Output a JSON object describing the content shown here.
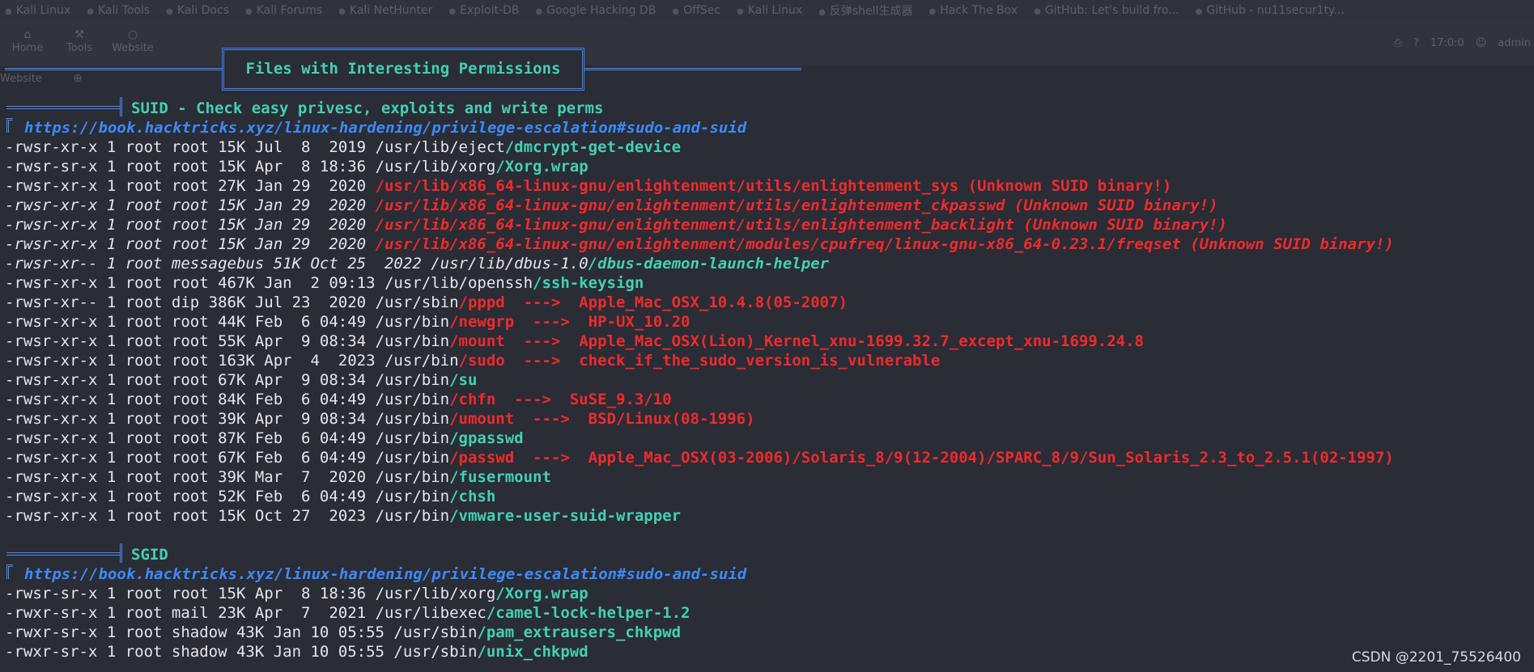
{
  "browser": {
    "bookmarks": [
      "Kali Linux",
      "Kali Tools",
      "Kali Docs",
      "Kali Forums",
      "Kali NetHunter",
      "Exploit-DB",
      "Google Hacking DB",
      "OffSec",
      "Kali Linux",
      "反弹shell生成器",
      "Hack The Box",
      "GitHub: Let's build fro...",
      "GitHub - nu11secur1ty..."
    ],
    "nav_items": [
      {
        "label": "Home",
        "icon": "home-icon"
      },
      {
        "label": "Tools",
        "icon": "wrench-icon"
      },
      {
        "label": "Website",
        "icon": "globe-icon"
      }
    ],
    "progress_text": "17:0:0",
    "user": "admin",
    "website_tab": "Website"
  },
  "header": {
    "title": "Files with Interesting Permissions"
  },
  "suid": {
    "title": "SUID - Check easy privesc, exploits and write perms",
    "url": "https://book.hacktricks.xyz/linux-hardening/privilege-escalation#sudo-and-suid",
    "lines": [
      {
        "italic": false,
        "prefix": "-rwsr-xr-x 1 root root 15K Jul  8  2019 /usr/lib/eject",
        "hl": "/dmcrypt-get-device",
        "hl_style": "teal",
        "suffix": ""
      },
      {
        "italic": false,
        "prefix": "-rwsr-sr-x 1 root root 15K Apr  8 18:36 /usr/lib/xorg",
        "hl": "/Xorg.wrap",
        "hl_style": "teal",
        "suffix": ""
      },
      {
        "italic": false,
        "prefix": "-rwsr-xr-x 1 root root 27K Jan 29  2020 ",
        "hl": "/usr/lib/x86_64-linux-gnu/enlightenment/utils/enlightenment_sys (Unknown SUID binary!)",
        "hl_style": "red",
        "suffix": ""
      },
      {
        "italic": true,
        "prefix": "-rwsr-xr-x 1 root root 15K Jan 29  2020 ",
        "hl": "/usr/lib/x86_64-linux-gnu/enlightenment/utils/enlightenment_ckpasswd (Unknown SUID binary!)",
        "hl_style": "redi",
        "suffix": ""
      },
      {
        "italic": true,
        "prefix": "-rwsr-xr-x 1 root root 15K Jan 29  2020 ",
        "hl": "/usr/lib/x86_64-linux-gnu/enlightenment/utils/enlightenment_backlight (Unknown SUID binary!)",
        "hl_style": "redi",
        "suffix": ""
      },
      {
        "italic": true,
        "prefix": "-rwsr-xr-x 1 root root 15K Jan 29  2020 ",
        "hl": "/usr/lib/x86_64-linux-gnu/enlightenment/modules/cpufreq/linux-gnu-x86_64-0.23.1/freqset (Unknown SUID binary!)",
        "hl_style": "redi",
        "suffix": ""
      },
      {
        "italic": true,
        "prefix": "-rwsr-xr-- 1 root messagebus 51K Oct 25  2022 /usr/lib/dbus-1.0",
        "hl": "/dbus-daemon-launch-helper",
        "hl_style": "teal",
        "suffix": ""
      },
      {
        "italic": false,
        "prefix": "-rwsr-xr-x 1 root root 467K Jan  2 09:13 /usr/lib/openssh",
        "hl": "/ssh-keysign",
        "hl_style": "teal",
        "suffix": ""
      },
      {
        "italic": false,
        "prefix": "-rwsr-xr-- 1 root dip 386K Jul 23  2020 /usr/sbin",
        "hl": "/pppd  --->  Apple_Mac_OSX_10.4.8(05-2007)",
        "hl_style": "red",
        "suffix": ""
      },
      {
        "italic": false,
        "prefix": "-rwsr-xr-x 1 root root 44K Feb  6 04:49 /usr/bin",
        "hl": "/newgrp  --->  HP-UX_10.20",
        "hl_style": "red",
        "suffix": ""
      },
      {
        "italic": false,
        "prefix": "-rwsr-xr-x 1 root root 55K Apr  9 08:34 /usr/bin",
        "hl": "/mount  --->  Apple_Mac_OSX(Lion)_Kernel_xnu-1699.32.7_except_xnu-1699.24.8",
        "hl_style": "red",
        "suffix": ""
      },
      {
        "italic": false,
        "prefix": "-rwsr-xr-x 1 root root 163K Apr  4  2023 /usr/bin",
        "hl": "/sudo  --->  check_if_the_sudo_version_is_vulnerable",
        "hl_style": "red",
        "suffix": ""
      },
      {
        "italic": false,
        "prefix": "-rwsr-xr-x 1 root root 67K Apr  9 08:34 /usr/bin",
        "hl": "/su",
        "hl_style": "teal",
        "suffix": ""
      },
      {
        "italic": false,
        "prefix": "-rwsr-xr-x 1 root root 84K Feb  6 04:49 /usr/bin",
        "hl": "/chfn  --->  SuSE_9.3/10",
        "hl_style": "red",
        "suffix": ""
      },
      {
        "italic": false,
        "prefix": "-rwsr-xr-x 1 root root 39K Apr  9 08:34 /usr/bin",
        "hl": "/umount  --->  BSD/Linux(08-1996)",
        "hl_style": "red",
        "suffix": ""
      },
      {
        "italic": false,
        "prefix": "-rwsr-xr-x 1 root root 87K Feb  6 04:49 /usr/bin",
        "hl": "/gpasswd",
        "hl_style": "teal",
        "suffix": ""
      },
      {
        "italic": false,
        "prefix": "-rwsr-xr-x 1 root root 67K Feb  6 04:49 /usr/bin",
        "hl": "/passwd  --->  Apple_Mac_OSX(03-2006)/Solaris_8/9(12-2004)/SPARC_8/9/Sun_Solaris_2.3_to_2.5.1(02-1997)",
        "hl_style": "red",
        "suffix": ""
      },
      {
        "italic": false,
        "prefix": "-rwsr-xr-x 1 root root 39K Mar  7  2020 /usr/bin",
        "hl": "/fusermount",
        "hl_style": "teal",
        "suffix": ""
      },
      {
        "italic": false,
        "prefix": "-rwsr-xr-x 1 root root 52K Feb  6 04:49 /usr/bin",
        "hl": "/chsh",
        "hl_style": "teal",
        "suffix": ""
      },
      {
        "italic": false,
        "prefix": "-rwsr-xr-x 1 root root 15K Oct 27  2023 /usr/bin",
        "hl": "/vmware-user-suid-wrapper",
        "hl_style": "teal",
        "suffix": ""
      }
    ]
  },
  "sgid": {
    "title": "SGID",
    "url": "https://book.hacktricks.xyz/linux-hardening/privilege-escalation#sudo-and-suid",
    "lines": [
      {
        "italic": false,
        "prefix": "-rwsr-sr-x 1 root root 15K Apr  8 18:36 /usr/lib/xorg",
        "hl": "/Xorg.wrap",
        "hl_style": "teal",
        "suffix": ""
      },
      {
        "italic": false,
        "prefix": "-rwxr-sr-x 1 root mail 23K Apr  7  2021 /usr/libexec",
        "hl": "/camel-lock-helper-1.2",
        "hl_style": "teal",
        "suffix": ""
      },
      {
        "italic": false,
        "prefix": "-rwxr-sr-x 1 root shadow 43K Jan 10 05:55 /usr/sbin",
        "hl": "/pam_extrausers_chkpwd",
        "hl_style": "teal",
        "suffix": ""
      },
      {
        "italic": false,
        "prefix": "-rwxr-sr-x 1 root shadow 43K Jan 10 05:55 /usr/sbin",
        "hl": "/unix_chkpwd",
        "hl_style": "teal",
        "suffix": ""
      }
    ]
  },
  "watermark": "CSDN @2201_75526400",
  "colors": {
    "background": "#2a2c36",
    "teal": "#43d0b0",
    "red": "#ee2b2b",
    "link_blue": "#3d8af7",
    "text": "#e6e6ea"
  }
}
